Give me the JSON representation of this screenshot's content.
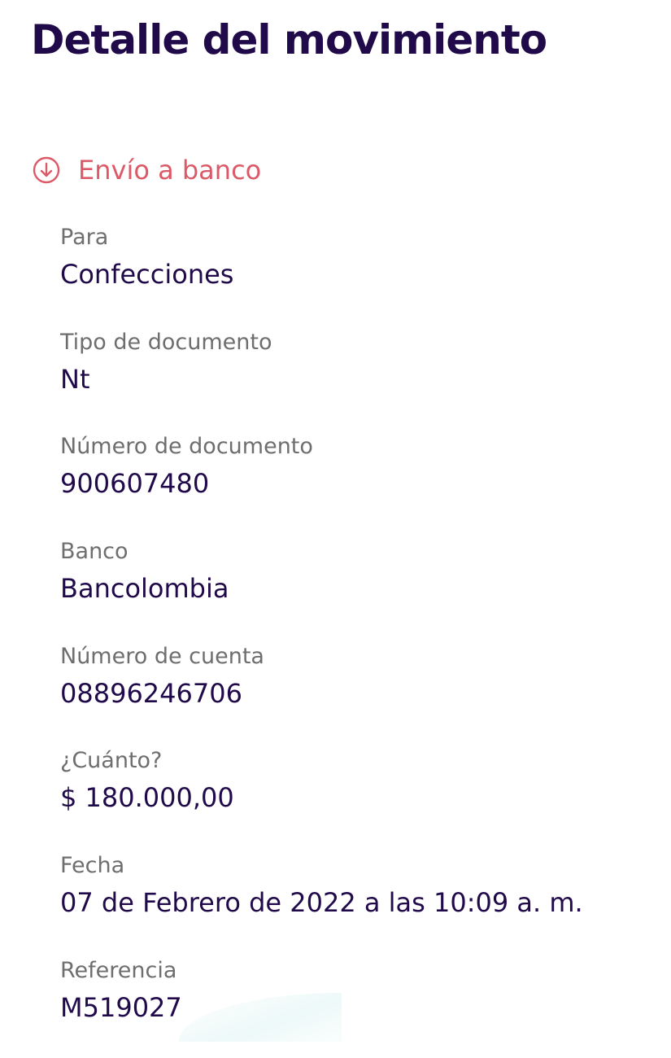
{
  "header": {
    "title": "Detalle del movimiento"
  },
  "transaction": {
    "type_label": "Envío a banco",
    "type_icon": "arrow-down-circle-icon",
    "accent_color": "#dc5a68"
  },
  "fields": [
    {
      "label": "Para",
      "value": "Confecciones"
    },
    {
      "label": "Tipo de documento",
      "value": "Nt"
    },
    {
      "label": "Número de documento",
      "value": "900607480"
    },
    {
      "label": "Banco",
      "value": "Bancolombia"
    },
    {
      "label": "Número de cuenta",
      "value": "08896246706"
    },
    {
      "label": "¿Cuánto?",
      "value": "$ 180.000,00"
    },
    {
      "label": "Fecha",
      "value": "07 de Febrero de 2022 a las 10:09 a. m."
    },
    {
      "label": "Referencia",
      "value": "M519027"
    }
  ],
  "colors": {
    "title": "#200a4a",
    "label": "#6e6e6e",
    "value": "#200a4a",
    "background": "#ffffff"
  }
}
